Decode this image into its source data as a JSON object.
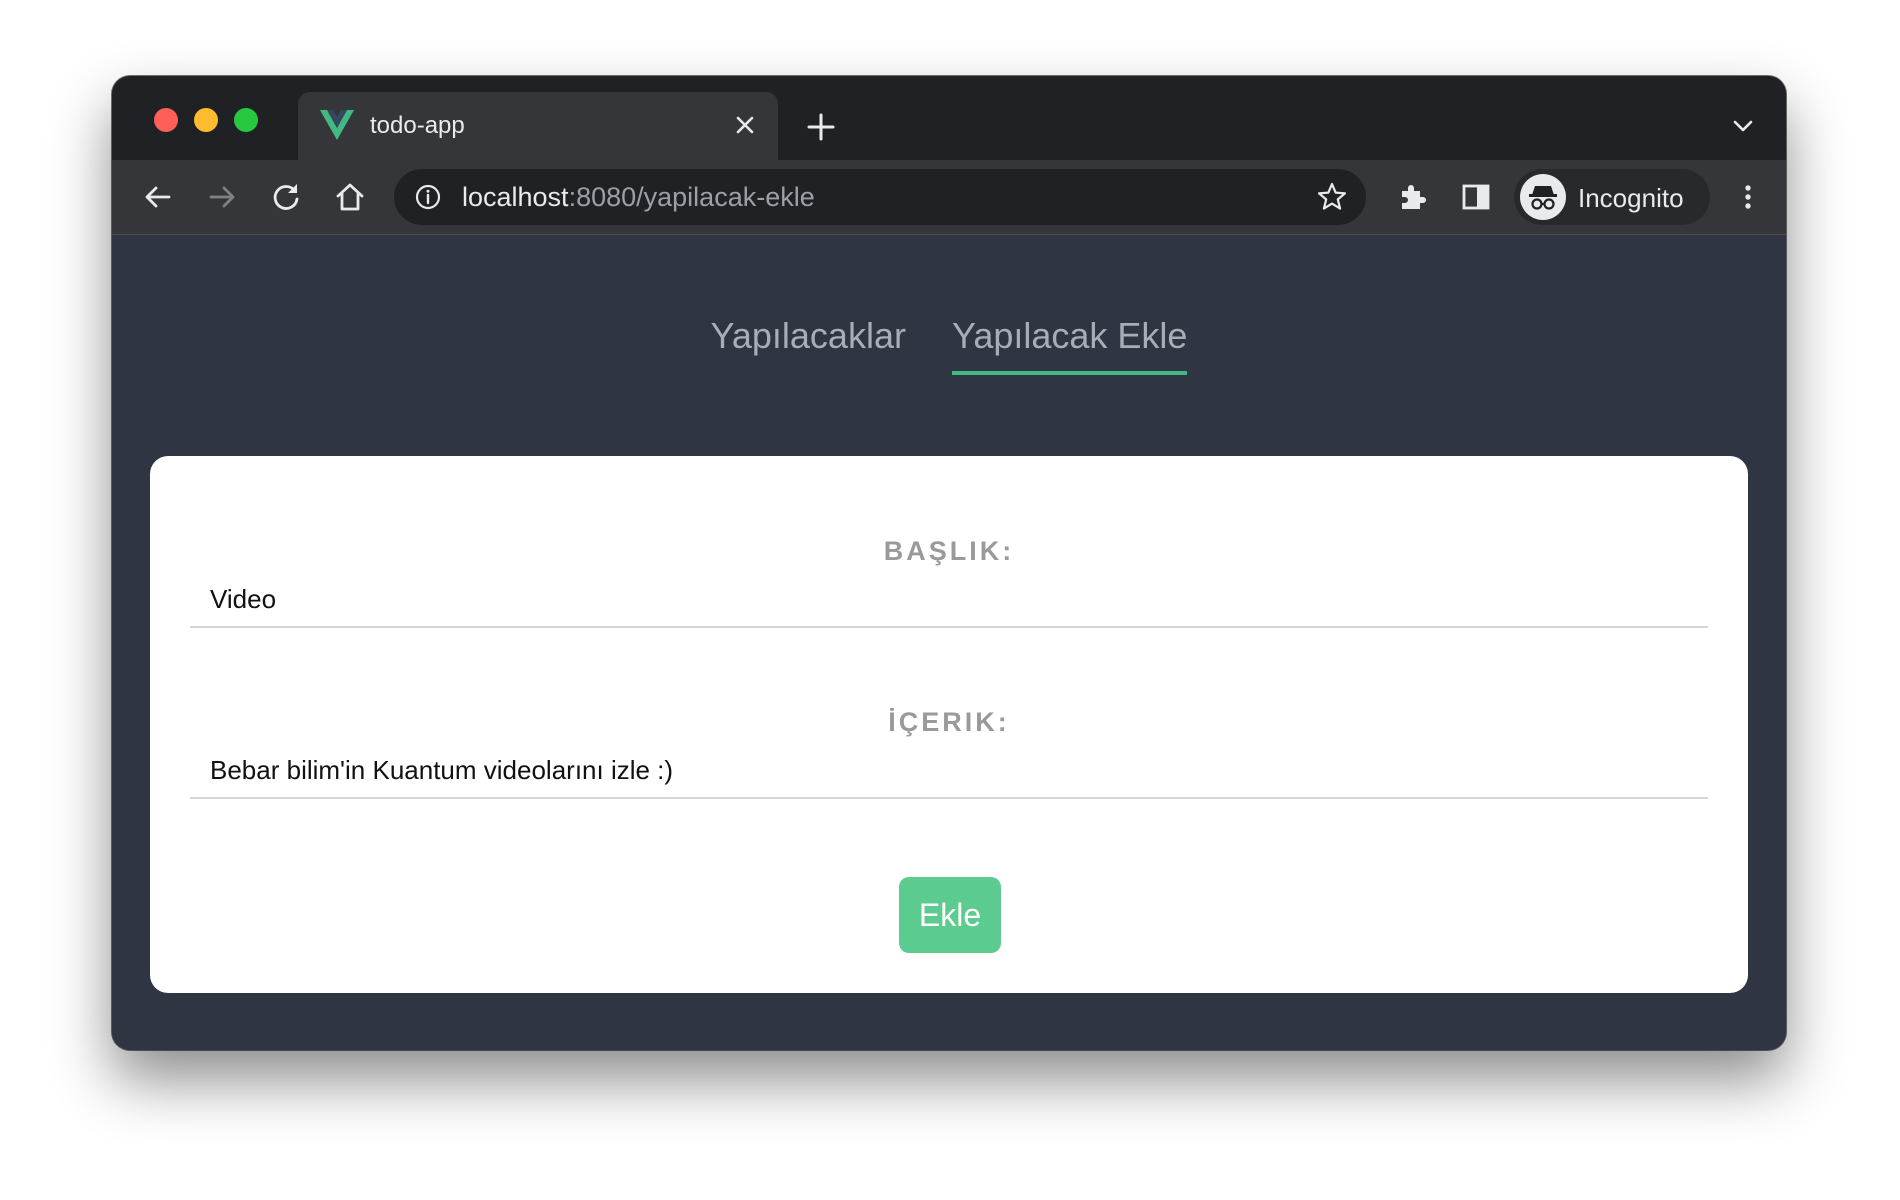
{
  "browser": {
    "tab": {
      "title": "todo-app",
      "favicon": "vue-logo-icon"
    },
    "toolbar": {
      "url_host": "localhost",
      "url_path": ":8080/yapilacak-ekle",
      "profile_label": "Incognito"
    }
  },
  "nav": {
    "links": [
      {
        "label": "Yapılacaklar",
        "active": false
      },
      {
        "label": "Yapılacak Ekle",
        "active": true
      }
    ],
    "accent_color": "#42b883"
  },
  "form": {
    "title_label": "BAŞLIK:",
    "title_value": "Video",
    "content_label": "İÇERIK:",
    "content_value": "Bebar bilim'in Kuantum videolarını izle :)",
    "submit_label": "Ekle",
    "button_color": "#5ccb8f"
  }
}
